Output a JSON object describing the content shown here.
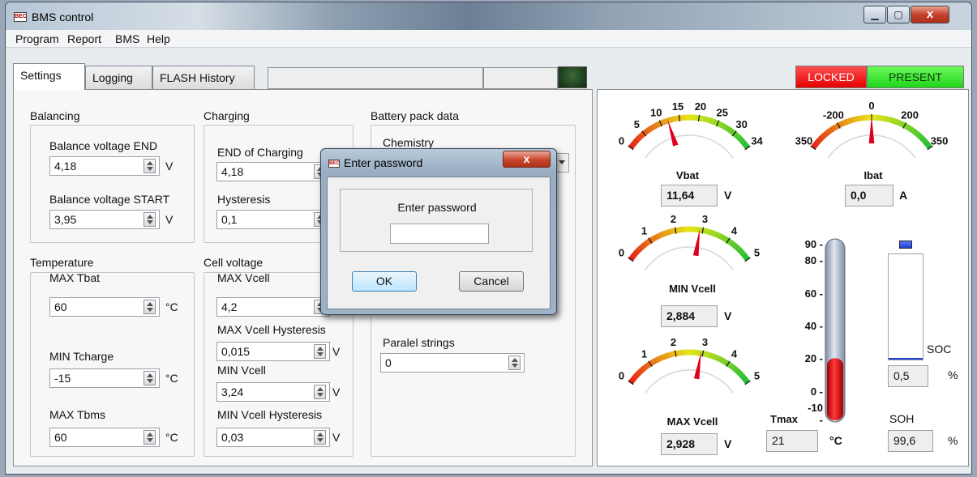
{
  "window": {
    "title": "BMS control",
    "icon": "app-logo-icon",
    "close_glyph": "x"
  },
  "menu": [
    "Program",
    "Report",
    "BMS",
    "Help"
  ],
  "tabs": [
    "Settings",
    "Logging",
    "FLASH History"
  ],
  "status": {
    "locked": "LOCKED",
    "present": "PRESENT",
    "locked_color": "#e40000",
    "present_color": "#1fd61a"
  },
  "balancing": {
    "title": "Balancing",
    "end_label": "Balance voltage END",
    "end_value": "4,18",
    "end_unit": "V",
    "start_label": "Balance voltage START",
    "start_value": "3,95",
    "start_unit": "V"
  },
  "charging": {
    "title": "Charging",
    "end_label": "END of Charging",
    "end_value": "4,18",
    "hyst_label": "Hysteresis",
    "hyst_value": "0,1"
  },
  "battery": {
    "title": "Battery pack data",
    "chemistry_label": "Chemistry",
    "strings_label": "Paralel strings",
    "strings_value": "0"
  },
  "temperature": {
    "title": "Temperature",
    "max_tbat_label": "MAX Tbat",
    "max_tbat_value": "60",
    "max_tbat_unit": "°C",
    "min_tcharge_label": "MIN Tcharge",
    "min_tcharge_value": "-15",
    "min_tcharge_unit": "°C",
    "max_tbms_label": "MAX Tbms",
    "max_tbms_value": "60",
    "max_tbms_unit": "°C"
  },
  "cell_voltage": {
    "title": "Cell voltage",
    "max_label": "MAX Vcell",
    "max_value": "4,2",
    "max_hyst_label": "MAX Vcell Hysteresis",
    "max_hyst_value": "0,015",
    "max_hyst_unit": "V",
    "min_label": "MIN Vcell",
    "min_value": "3,24",
    "min_unit": "V",
    "min_hyst_label": "MIN Vcell Hysteresis",
    "min_hyst_value": "0,03",
    "min_hyst_unit": "V"
  },
  "dialog": {
    "title": "Enter password",
    "prompt": "Enter password",
    "password_value": "",
    "ok": "OK",
    "cancel": "Cancel",
    "close_glyph": "x"
  },
  "gauges": {
    "vbat": {
      "label": "Vbat",
      "value": "11,64",
      "unit": "V",
      "ticks": [
        "0",
        "5",
        "10",
        "15",
        "20",
        "25",
        "30",
        "34"
      ],
      "min": 0,
      "max": 34,
      "needle": 11.64
    },
    "ibat": {
      "label": "Ibat",
      "value": "0,0",
      "unit": "A",
      "ticks": [
        "350",
        "-200",
        "0",
        "200",
        "350"
      ],
      "min": -350,
      "max": 350,
      "needle": 0
    },
    "min_vcell": {
      "label": "MIN Vcell",
      "value": "2,884",
      "unit": "V",
      "ticks": [
        "0",
        "1",
        "2",
        "3",
        "4",
        "5"
      ],
      "min": 0,
      "max": 5,
      "needle": 2.884
    },
    "max_vcell": {
      "label": "MAX Vcell",
      "value": "2,928",
      "unit": "V",
      "ticks": [
        "0",
        "1",
        "2",
        "3",
        "4",
        "5"
      ],
      "min": 0,
      "max": 5,
      "needle": 2.928
    }
  },
  "thermometer": {
    "label": "Tmax",
    "value": "21",
    "unit": "°C",
    "ticks": [
      "90",
      "80",
      "60",
      "40",
      "20",
      "0",
      "-10"
    ],
    "min": -10,
    "max": 90,
    "level": 21
  },
  "soc": {
    "label": "SOC",
    "value": "0,5",
    "unit": "%",
    "level": 0.005
  },
  "soh": {
    "label": "SOH",
    "value": "99,6",
    "unit": "%"
  }
}
